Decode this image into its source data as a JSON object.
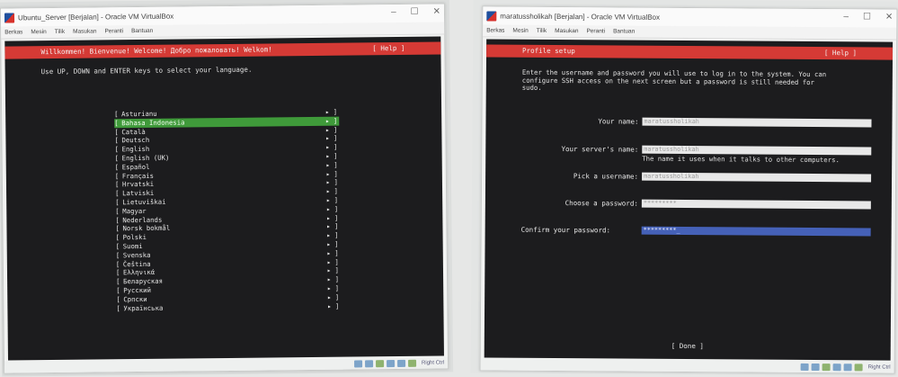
{
  "left": {
    "window_title": "Ubuntu_Server [Berjalan] - Oracle VM VirtualBox",
    "menu": [
      "Berkas",
      "Mesin",
      "Tilik",
      "Masukan",
      "Peranti",
      "Bantuan"
    ],
    "header_title": "Willkommen! Bienvenue! Welcome! Добро пожаловать! Welkom!",
    "help_label": "[ Help ]",
    "instruction": "Use UP, DOWN and ENTER keys to select your language.",
    "languages": [
      {
        "label": "Asturianu",
        "selected": false
      },
      {
        "label": "Bahasa Indonesia",
        "selected": true
      },
      {
        "label": "Català",
        "selected": false
      },
      {
        "label": "Deutsch",
        "selected": false
      },
      {
        "label": "English",
        "selected": false
      },
      {
        "label": "English (UK)",
        "selected": false
      },
      {
        "label": "Español",
        "selected": false
      },
      {
        "label": "Français",
        "selected": false
      },
      {
        "label": "Hrvatski",
        "selected": false
      },
      {
        "label": "Latviski",
        "selected": false
      },
      {
        "label": "Lietuviškai",
        "selected": false
      },
      {
        "label": "Magyar",
        "selected": false
      },
      {
        "label": "Nederlands",
        "selected": false
      },
      {
        "label": "Norsk bokmål",
        "selected": false
      },
      {
        "label": "Polski",
        "selected": false
      },
      {
        "label": "Suomi",
        "selected": false
      },
      {
        "label": "Svenska",
        "selected": false
      },
      {
        "label": "Čeština",
        "selected": false
      },
      {
        "label": "Ελληνικά",
        "selected": false
      },
      {
        "label": "Беларуская",
        "selected": false
      },
      {
        "label": "Русский",
        "selected": false
      },
      {
        "label": "Српски",
        "selected": false
      },
      {
        "label": "Українська",
        "selected": false
      }
    ],
    "arrow": "▸ ]",
    "bracket_open": "["
  },
  "right": {
    "window_title": "maratussholikah [Berjalan] - Oracle VM VirtualBox",
    "menu": [
      "Berkas",
      "Mesin",
      "Tilik",
      "Masukan",
      "Peranti",
      "Bantuan"
    ],
    "header_title": "Profile setup",
    "help_label": "[ Help ]",
    "description_lines": [
      "Enter the username and password you will use to log in to the system. You can",
      "configure SSH access on the next screen but a password is still needed for",
      "sudo."
    ],
    "fields": {
      "your_name": {
        "label": "Your name:",
        "value": "maratussholikah"
      },
      "server_name": {
        "label": "Your server's name:",
        "value": "maratussholikah",
        "hint": "The name it uses when it talks to other computers."
      },
      "username": {
        "label": "Pick a username:",
        "value": "maratussholikah"
      },
      "password": {
        "label": "Choose a password:",
        "value": "*********"
      },
      "confirm": {
        "label": "Confirm your password:",
        "value": "*********_"
      }
    },
    "done_label": "[ Done      ]",
    "right_ctrl": "Right Ctrl"
  },
  "colors": {
    "header_red": "#d53a35",
    "select_green": "#3f9a3a",
    "active_field_blue": "#4561b8",
    "terminal_bg": "#1c1c1e"
  }
}
